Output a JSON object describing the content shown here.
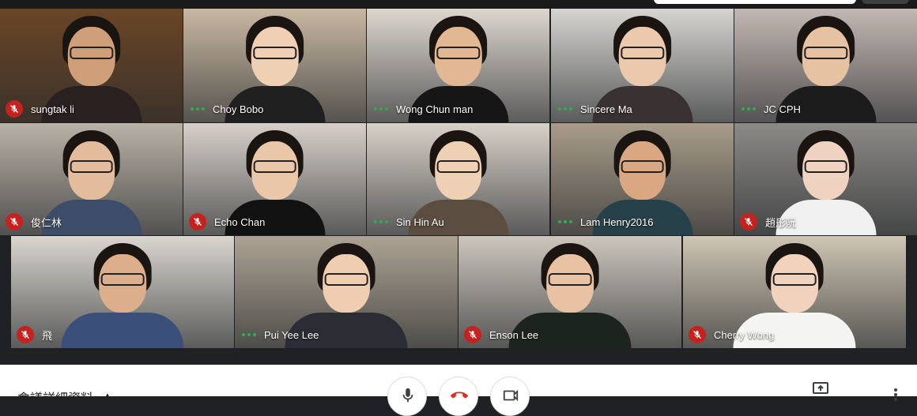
{
  "participants": [
    {
      "name": "sungtak li",
      "muted": true,
      "bg": "#6b4526",
      "face": "#cf9f7a",
      "body": "#2a2020"
    },
    {
      "name": "Choy Bobo",
      "muted": false,
      "bg": "#c9b8a2",
      "face": "#f0d0b5",
      "body": "#202020"
    },
    {
      "name": "Wong Chun man",
      "muted": false,
      "bg": "#ddd7cf",
      "face": "#e2b894",
      "body": "#161616"
    },
    {
      "name": "Sincere Ma",
      "muted": false,
      "bg": "#d7d5d2",
      "face": "#ecc9ac",
      "body": "#3a3232"
    },
    {
      "name": "JC CPH",
      "muted": false,
      "bg": "#c3b8b3",
      "face": "#e6c1a2",
      "body": "#1c1c1c"
    },
    {
      "name": "俊仁林",
      "muted": true,
      "bg": "#b9b2a7",
      "face": "#e2bc9c",
      "body": "#3d4d69"
    },
    {
      "name": "Echo Chan",
      "muted": true,
      "bg": "#d6d0c9",
      "face": "#eac7a9",
      "body": "#121212"
    },
    {
      "name": "Sin Hin Au",
      "muted": false,
      "bg": "#d8d1c8",
      "face": "#eed0b4",
      "body": "#5b4d3f"
    },
    {
      "name": "Lam Henry2016",
      "muted": false,
      "bg": "#a99c8a",
      "face": "#d9a883",
      "body": "#27414a"
    },
    {
      "name": "趙彤阮",
      "muted": true,
      "bg": "#8c8a87",
      "face": "#efd2bf",
      "body": "#f0f0f0"
    },
    {
      "name": "飛",
      "muted": true,
      "bg": "#dad6cf",
      "face": "#dcae8c",
      "body": "#3a4f7a"
    },
    {
      "name": "Pui Yee Lee",
      "muted": false,
      "bg": "#ada394",
      "face": "#f0cdb0",
      "body": "#2c2c34"
    },
    {
      "name": "Enson Lee",
      "muted": true,
      "bg": "#ccc6bd",
      "face": "#e8c2a2",
      "body": "#1c2420"
    },
    {
      "name": "Cherry Wong",
      "muted": true,
      "bg": "#cfc6b4",
      "face": "#f1d3bd",
      "body": "#f4f4f2"
    }
  ],
  "bottom_bar": {
    "meeting_details_label": "會議詳細資料",
    "buttons": [
      "mic-button",
      "leave-call-button",
      "camera-button"
    ]
  },
  "colors": {
    "accent_red": "#c5221f",
    "speaking_green": "#34a853",
    "dark_bg": "#202124"
  }
}
